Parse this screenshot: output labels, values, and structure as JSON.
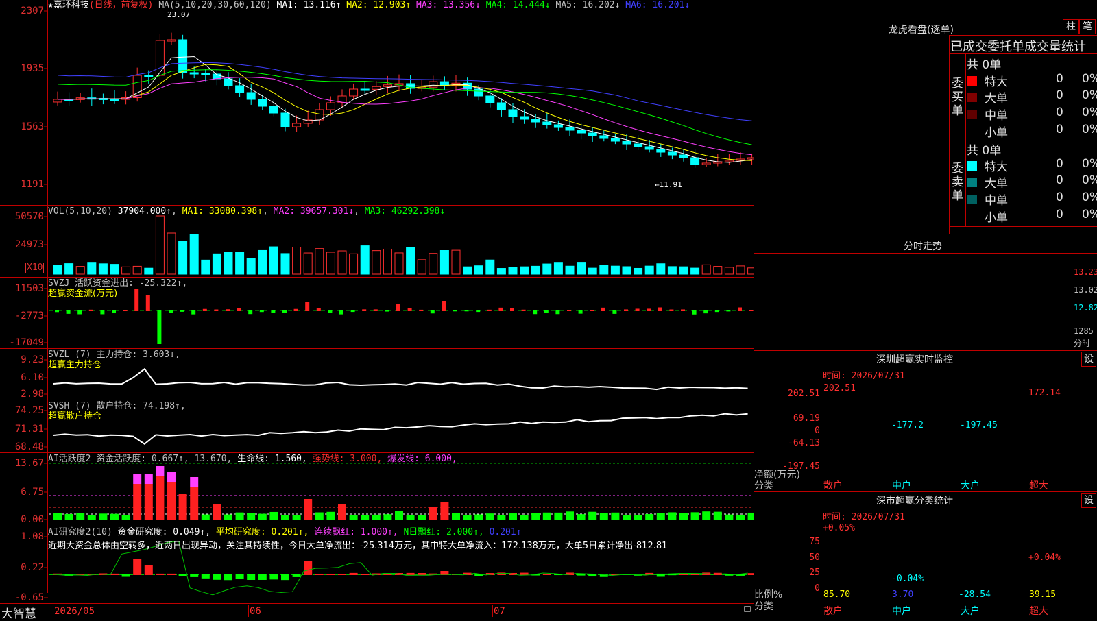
{
  "app": {
    "brand": "大智慧"
  },
  "stock": {
    "star": "★",
    "name": "嘉环科技",
    "mode": "(日线，前复权)"
  },
  "colors": {
    "up": "#ff3030",
    "down": "#00ffff",
    "grid": "#c00000",
    "ma1": "#ffffff",
    "ma2": "#ffff00",
    "ma3": "#ff40ff",
    "ma4": "#00ff00",
    "ma5": "#4040ff"
  },
  "kline": {
    "ylabels": [
      "2307",
      "1935",
      "1563",
      "1191"
    ],
    "ma_header": "MA(5,10,20,30,60,120)",
    "ma": [
      {
        "label": "MA1: 13.116↑",
        "color": "#ffffff"
      },
      {
        "label": "MA2: 12.903↑",
        "color": "#ffff00"
      },
      {
        "label": "MA3: 13.356↓",
        "color": "#ff40ff"
      },
      {
        "label": "MA4: 14.444↓",
        "color": "#00ff00"
      },
      {
        "label": "MA5: 16.202↓",
        "color": "#c0c0c0"
      },
      {
        "label": "MA6: 16.201↓",
        "color": "#4040ff"
      }
    ],
    "high_label": "23.07",
    "low_label": "←11.91"
  },
  "vol": {
    "ylabels": [
      "50570",
      "24973",
      "X10"
    ],
    "header": "VOL(5,10,20)",
    "value": "37904.000↑",
    "ma": [
      {
        "label": "MA1: 33080.398↑",
        "color": "#ffff00"
      },
      {
        "label": "MA2: 39657.301↓",
        "color": "#ff40ff"
      },
      {
        "label": "MA3: 46292.398↓",
        "color": "#00ff00"
      }
    ]
  },
  "svzj": {
    "ylabels": [
      "11503",
      "-2773",
      "-17049"
    ],
    "header": "SVZJ  活跃资金进出: -25.322↑,",
    "sub": "超赢资金流(万元)"
  },
  "svzl": {
    "ylabels": [
      "9.23",
      "6.10",
      "2.98"
    ],
    "header": "SVZL (7) 主力持仓: 3.603↓,",
    "sub": "超赢主力持仓"
  },
  "svsh": {
    "ylabels": [
      "74.25",
      "71.31",
      "68.48"
    ],
    "header": "SVSH (7) 散户持仓: 74.198↑,",
    "sub": "超赢散户持仓"
  },
  "ai_active": {
    "ylabels": [
      "13.67",
      "6.75",
      "0.00"
    ],
    "header_a": "AI活跃度2 资金活跃度: 0.667↑,",
    "header_b": "13.670,",
    "header_c": "生命线: 1.560,",
    "header_d": "强势线: 3.000,",
    "header_e": "爆发线: 6.000,"
  },
  "ai_research": {
    "ylabels": [
      "1.08",
      "0.22",
      "-0.65"
    ],
    "header_a": "AI研究度2(10)",
    "header_b": "资金研究度: 0.049↑,",
    "header_c": "平均研究度: 0.201↑,",
    "header_d": "连续飘红: 1.000↑,",
    "header_e": "N日飘红: 2.000↑,",
    "header_f": "0.201↑",
    "summary": "近期大资金总体由空转多，近两日出现异动，关注其持续性，今日大单净流出：-25.314万元，其中特大单净流入：172.138万元，大单5日累计净出-812.81"
  },
  "xaxis": {
    "labels": [
      "2026/05",
      "06",
      "07"
    ]
  },
  "dragon": {
    "title": "龙虎看盘(逐单)",
    "tab1": "柱",
    "tab2": "笔",
    "stat_title": "已成交委托单成交量统计",
    "buy": {
      "side_label": "委买单",
      "total": "共 0单",
      "rows": [
        {
          "label": "特大",
          "count": "0",
          "pct": "0%",
          "color": "#ff0000"
        },
        {
          "label": "大单",
          "count": "0",
          "pct": "0%",
          "color": "#800000"
        },
        {
          "label": "中单",
          "count": "0",
          "pct": "0%",
          "color": "#600000"
        },
        {
          "label": "小单",
          "count": "0",
          "pct": "0%",
          "color": "#000000"
        }
      ]
    },
    "sell": {
      "side_label": "委卖单",
      "total": "共 0单",
      "rows": [
        {
          "label": "特大",
          "count": "0",
          "pct": "0%",
          "color": "#00ffff"
        },
        {
          "label": "大单",
          "count": "0",
          "pct": "0%",
          "color": "#008080"
        },
        {
          "label": "中单",
          "count": "0",
          "pct": "0%",
          "color": "#006060"
        },
        {
          "label": "小单",
          "count": "0",
          "pct": "0%",
          "color": "#000000"
        }
      ]
    }
  },
  "intraday": {
    "title": "分时走势",
    "ylabels": [
      "13.23",
      "13.02",
      "12.82",
      "1285",
      "分时"
    ]
  },
  "sz_monitor": {
    "title": "深圳超赢实时监控",
    "set": "设",
    "time": "时间: 2026/07/31",
    "ylabels": [
      "202.51",
      "69.19",
      "0",
      "-64.13",
      "-197.45"
    ],
    "unit_label": "净额(万元)",
    "cat_label": "分类",
    "categories": [
      "散户",
      "中户",
      "大户",
      "超大"
    ],
    "values": [
      202.51,
      -177.2,
      -197.45,
      172.14
    ],
    "value_labels": [
      "202.51",
      "-177.2",
      "-197.45",
      "172.14"
    ]
  },
  "sz_class": {
    "title": "深市超赢分类统计",
    "set": "设",
    "time": "时间: 2026/07/31",
    "ylabels": [
      "75",
      "50",
      "25",
      "0"
    ],
    "unit_label": "比例%",
    "cat_label": "分类",
    "top_labels": [
      "+0.05%",
      "-0.04%",
      "+0.04%"
    ],
    "categories": [
      "散户",
      "中户",
      "大户",
      "超大"
    ],
    "values": [
      85.7,
      3.7,
      -28.54,
      39.15
    ],
    "value_labels": [
      "85.70",
      "3.70",
      "-28.54",
      "39.15"
    ]
  }
}
